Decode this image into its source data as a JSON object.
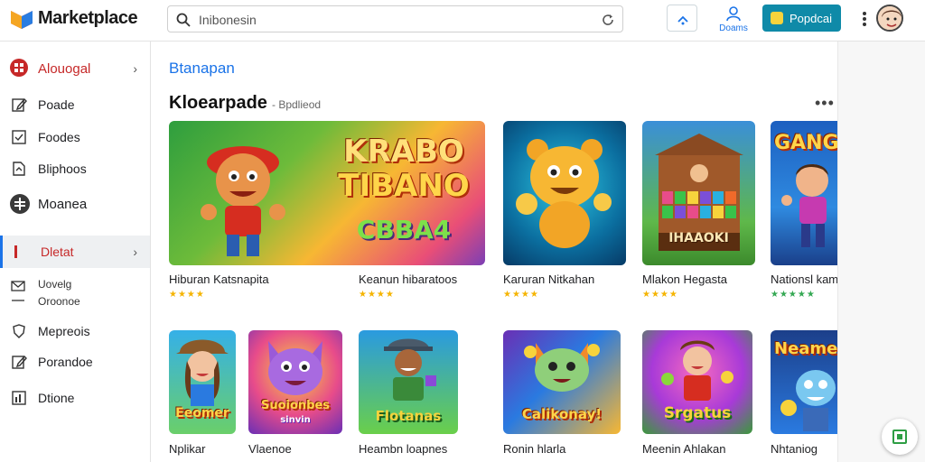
{
  "header": {
    "brand": "Marketplace",
    "search": {
      "value": "Inibonesin"
    },
    "account_label": "Doams",
    "cta_label": "Popdcai"
  },
  "sidebar": {
    "items": [
      {
        "label": "Alouogal",
        "icon": "category-icon"
      },
      {
        "label": "Poade",
        "icon": "edit-icon"
      },
      {
        "label": "Foodes",
        "icon": "list-icon"
      },
      {
        "label": "Bliphoos",
        "icon": "document-icon"
      },
      {
        "label": "Moanea",
        "icon": "globe-icon"
      },
      {
        "label": "Dletat",
        "icon": "bar-icon"
      },
      {
        "label": "Uovelg",
        "icon": "mail-icon"
      },
      {
        "label": "Oroonoe",
        "icon": ""
      },
      {
        "label": "Mepreois",
        "icon": "shield-icon"
      },
      {
        "label": "Porandoe",
        "icon": "edit-icon"
      },
      {
        "label": "Dtione",
        "icon": "chart-icon"
      }
    ]
  },
  "main": {
    "breadcrumb": "Btanapan",
    "section_title": "Kloearpade",
    "section_subtitle": "- Bpdlieod",
    "row1": [
      {
        "name": "Hiburan Katsnapita",
        "art_title": "KRABO",
        "art_title2": "TIBANO",
        "art_title3": "CBBA4",
        "stars": "★★★★",
        "star_color": "gold"
      },
      {
        "name": "Keanun hibaratoos",
        "art_title": "",
        "stars": "★★★★",
        "star_color": "gold"
      },
      {
        "name": "Karuran Nitkahan",
        "art_title": "",
        "stars": "★★★★",
        "star_color": "gold"
      },
      {
        "name": "Mlakon Hegasta",
        "art_title": "IHAAOKI",
        "stars": "★★★★",
        "star_color": "gold"
      },
      {
        "name": "Nationsl kam",
        "art_title": "GANG",
        "stars": "★★★★★",
        "star_color": "green"
      }
    ],
    "row2": [
      {
        "name": "Nplikar",
        "art_title": "Eeomer"
      },
      {
        "name": "Vlaenoe",
        "art_title": "Suoionbes",
        "art_title2": "sinvin"
      },
      {
        "name": "Heambn loapnes",
        "art_title": "Flotanas"
      },
      {
        "name": "Ronin hlarla",
        "art_title": "Calikonay!"
      },
      {
        "name": "Meenin Ahlakan",
        "art_title": "Srgatus"
      },
      {
        "name": "Nhtaniog",
        "art_title": "Neame"
      }
    ]
  },
  "colors": {
    "accent": "#1a73e8",
    "cta": "#0f8aa8",
    "active_text": "#c62828",
    "star": "#f5b400"
  }
}
